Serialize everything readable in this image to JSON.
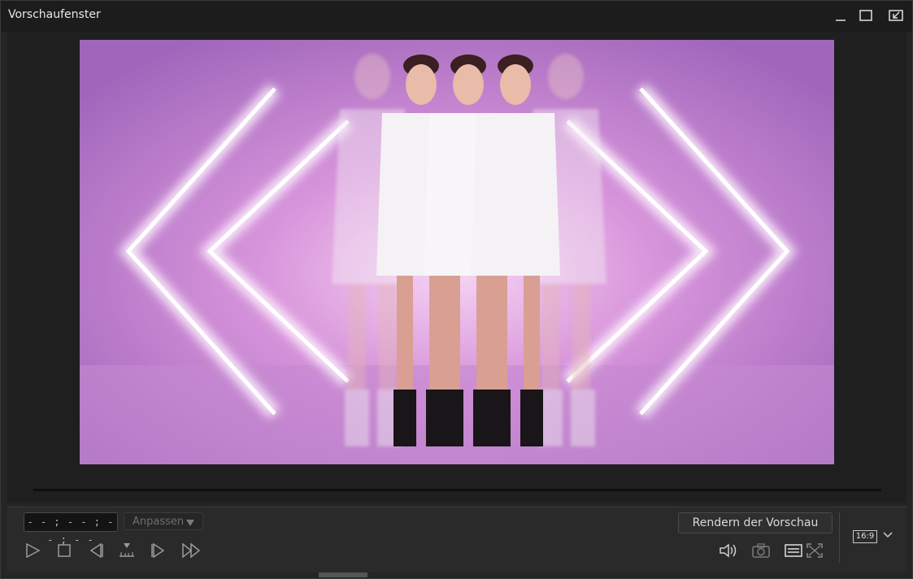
{
  "window": {
    "title": "Vorschaufenster",
    "controls": [
      "minimize-icon",
      "maximize-icon",
      "undock-icon"
    ]
  },
  "preview": {
    "description_hidden": true
  },
  "playback": {
    "timecode": "- - ; - - ; - - ; - -",
    "fit_label": "Anpassen",
    "render_label": "Rendern der Vorschau",
    "aspect_ratio": "16:9",
    "buttons": [
      "play-icon",
      "stop-icon",
      "previous-frame-icon",
      "split-icon",
      "next-frame-icon",
      "fast-forward-icon"
    ],
    "right_tools": [
      "volume-icon",
      "snapshot-camera-icon",
      "subtitles-icon",
      "fullscreen-icon"
    ]
  },
  "colors": {
    "background": "#252525",
    "titlebar": "#1c1c1c",
    "video_glow": "#f3c6f0",
    "video_purple": "#b070c4"
  }
}
